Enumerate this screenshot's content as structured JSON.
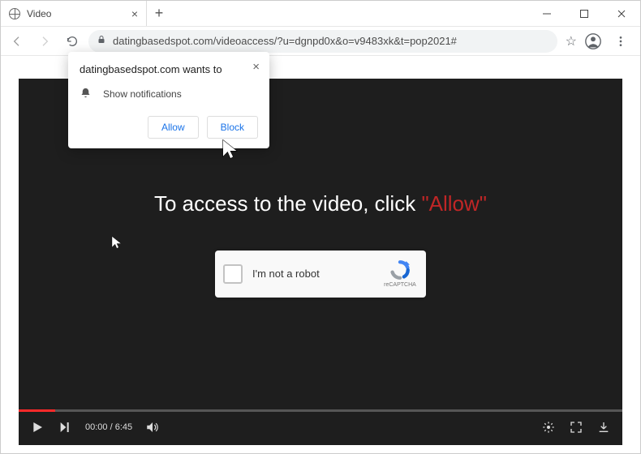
{
  "window": {
    "tab_title": "Video"
  },
  "toolbar": {
    "url": "datingbasedspot.com/videoaccess/?u=dgnpd0x&o=v9483xk&t=pop2021#"
  },
  "permission": {
    "header": "datingbasedspot.com wants to",
    "item": "Show notifications",
    "allow": "Allow",
    "block": "Block"
  },
  "page": {
    "message_prefix": "To access to the video, click ",
    "message_highlight": "\"Allow\""
  },
  "recaptcha": {
    "label": "I'm not a robot",
    "brand": "reCAPTCHA"
  },
  "video": {
    "current_time": "00:00",
    "duration": "6:45",
    "progress_percent": 6
  }
}
